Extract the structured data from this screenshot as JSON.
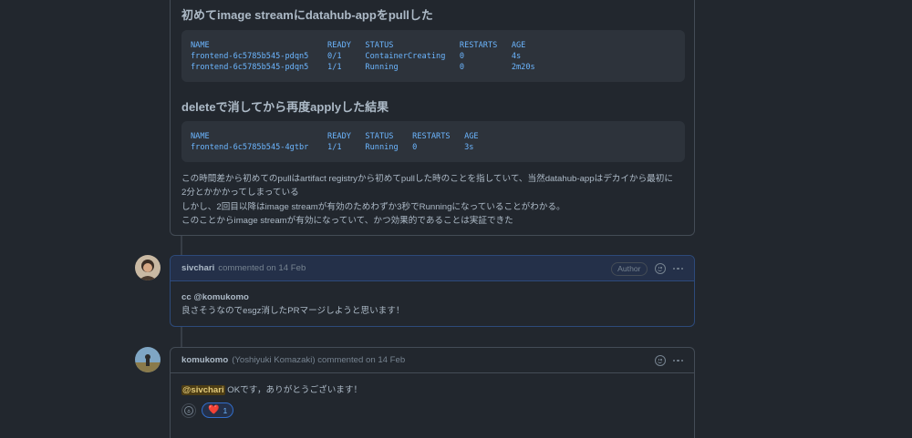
{
  "first_comment": {
    "heading1": "初めてimage streamにdatahub-appをpullした",
    "code1": {
      "lines": [
        "NAME                         READY   STATUS              RESTARTS   AGE",
        "frontend-6c5785b545-pdqn5    0/1     ContainerCreating   0          4s",
        "frontend-6c5785b545-pdqn5    1/1     Running             0          2m20s"
      ]
    },
    "heading2": "deleteで消してから再度applyした結果",
    "code2": {
      "lines": [
        "NAME                         READY   STATUS    RESTARTS   AGE",
        "frontend-6c5785b545-4gtbr    1/1     Running   0          3s"
      ]
    },
    "para_lines": [
      "この時間差から初めてのpullはartifact registryから初めてpullした時のことを指していて、当然datahub-appはデカイから最初に",
      "2分とかかかってしまっている",
      "しかし、2回目以降はimage streamが有効のためわずか3秒でRunningになっていることがわかる。",
      "このことからimage streamが有効になっていて、かつ効果的であることは実証できた"
    ]
  },
  "comment2": {
    "author": "sivchari",
    "meta": "commented on 14 Feb",
    "badge": "Author",
    "body_mention": "cc @komukomo",
    "body_text": "良さそうなのでesgz消したPRマージしようと思います！"
  },
  "comment3": {
    "author": "komukomo",
    "meta": "(Yoshiyuki Komazaki) commented on 14 Feb",
    "body_mention": "@sivchari",
    "body_text": " OKです，ありがとうございます！",
    "reaction_emoji": "❤️",
    "reaction_count": "1"
  },
  "icons": [
    "smiley-icon",
    "kebab-menu-icon",
    "heart-emoji",
    "avatar"
  ]
}
